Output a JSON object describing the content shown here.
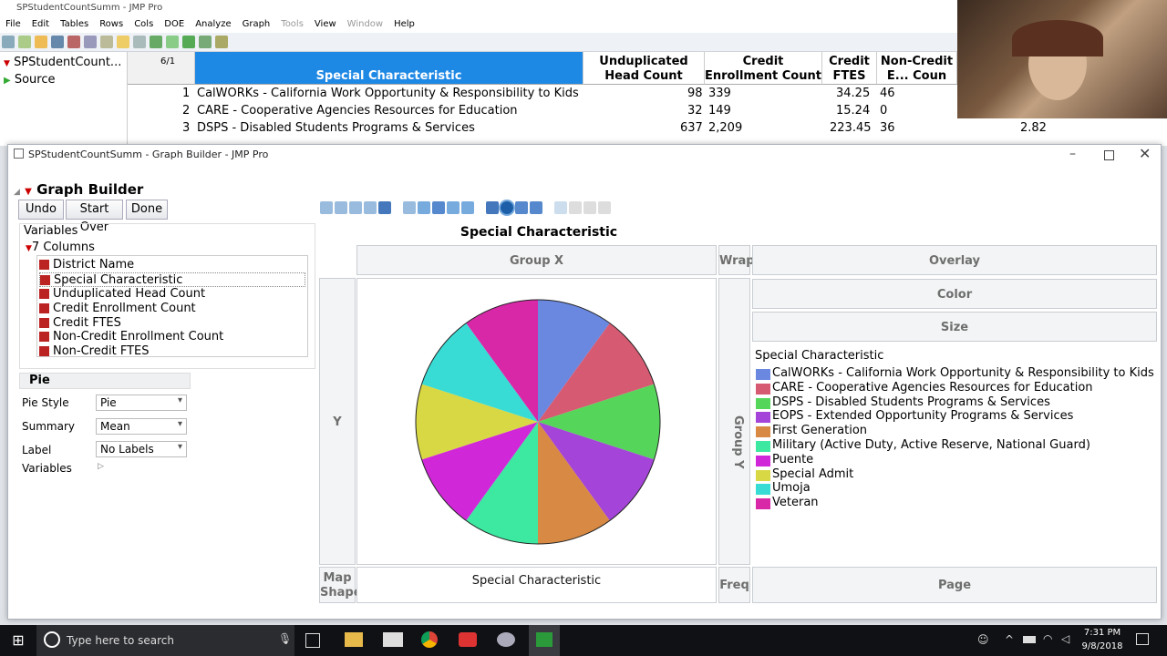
{
  "bg_window": {
    "title": "SPStudentCountSumm - JMP Pro",
    "menu": [
      "File",
      "Edit",
      "Tables",
      "Rows",
      "Cols",
      "DOE",
      "Analyze",
      "Graph",
      "Tools",
      "View",
      "Window",
      "Help"
    ],
    "panel_item": "SPStudentCount...",
    "source": "Source",
    "rows_label": "6/1",
    "columns": [
      "Special Characteristic",
      "Unduplicated Head Count",
      "Credit Enrollment Count",
      "Credit FTES",
      "Non-Credit E... Coun"
    ],
    "rows": [
      {
        "n": "1",
        "name": "CalWORKs - California Work Opportunity & Responsibility to Kids",
        "head": "98",
        "credit": "339",
        "ftes": "34.25",
        "noncredit": "46",
        "extra": ""
      },
      {
        "n": "2",
        "name": "CARE - Cooperative Agencies Resources for Education",
        "head": "32",
        "credit": "149",
        "ftes": "15.24",
        "noncredit": "0",
        "extra": ""
      },
      {
        "n": "3",
        "name": "DSPS - Disabled Students Programs & Services",
        "head": "637",
        "credit": "2,209",
        "ftes": "223.45",
        "noncredit": "36",
        "extra": "2.82"
      }
    ]
  },
  "gb": {
    "title": "SPStudentCountSumm - Graph Builder - JMP Pro",
    "heading": "Graph Builder",
    "buttons": {
      "undo": "Undo",
      "start_over": "Start Over",
      "done": "Done"
    },
    "variables_label": "Variables",
    "columns_label": "7 Columns",
    "columns": [
      "District Name",
      "Special Characteristic",
      "Unduplicated Head Count",
      "Credit Enrollment Count",
      "Credit FTES",
      "Non-Credit Enrollment Count",
      "Non-Credit FTES"
    ],
    "pie_section": "Pie",
    "pie_style_label": "Pie Style",
    "pie_style": "Pie",
    "summary_label": "Summary",
    "summary": "Mean",
    "label_label": "Label",
    "label_value": "No Labels",
    "variables2": "Variables",
    "graph_title": "Special Characteristic",
    "zones": {
      "group_x": "Group X",
      "wrap": "Wrap",
      "overlay": "Overlay",
      "color": "Color",
      "size": "Size",
      "y": "Y",
      "group_y": "Group Y",
      "map_shape": "Map Shape",
      "x_label": "Special Characteristic",
      "freq": "Freq",
      "page": "Page"
    },
    "legend_title": "Special Characteristic"
  },
  "chart_data": {
    "type": "pie",
    "title": "Special Characteristic",
    "categories": [
      "CalWORKs - California Work Opportunity & Responsibility to Kids",
      "CARE - Cooperative Agencies Resources for Education",
      "DSPS - Disabled Students Programs & Services",
      "EOPS - Extended Opportunity Programs & Services",
      "First Generation",
      "Military (Active Duty, Active Reserve, National Guard)",
      "Puente",
      "Special Admit",
      "Umoja",
      "Veteran"
    ],
    "values": [
      1,
      1,
      1,
      1,
      1,
      1,
      1,
      1,
      1,
      1
    ],
    "colors": [
      "#6b88e0",
      "#d65a72",
      "#55d65a",
      "#a444d8",
      "#d88a44",
      "#3de8a0",
      "#d028d8",
      "#d8d844",
      "#38dcd4",
      "#d828a8"
    ],
    "legend": "right"
  },
  "taskbar": {
    "search": "Type here to search",
    "time": "7:31 PM",
    "date": "9/8/2018"
  }
}
